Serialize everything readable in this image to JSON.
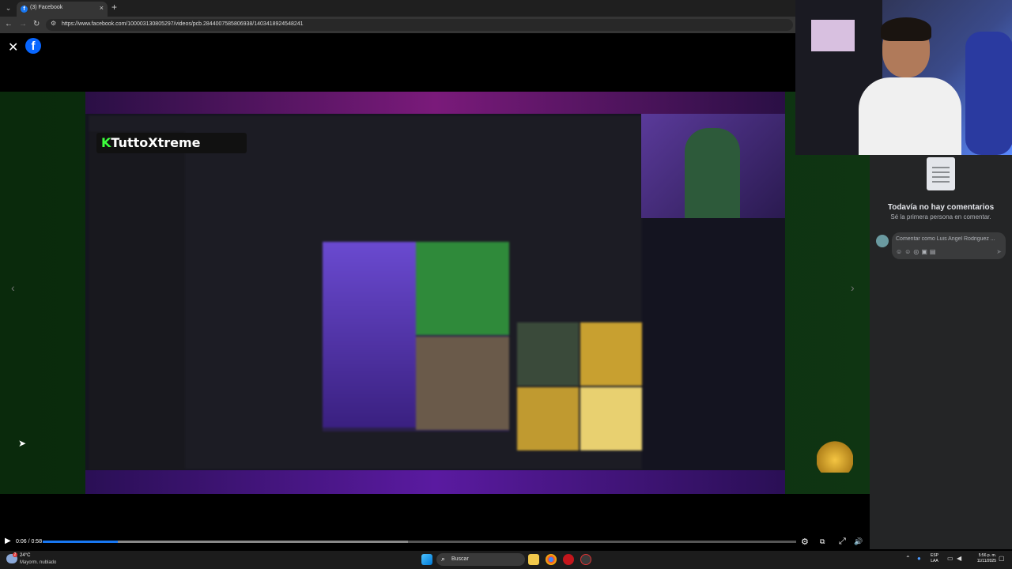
{
  "browser": {
    "tab_title": "(3) Facebook",
    "tab_favicon": "f",
    "tab_close": "×",
    "new_tab": "+",
    "tab_list": "⌄",
    "url": "https://www.facebook.com/100003130805297/videos/pcb.2844007585806938/1403418924548241",
    "back": "←",
    "forward": "→",
    "reload": "↻",
    "site_info": "⚙"
  },
  "viewer": {
    "close": "✕",
    "fb_logo": "f",
    "prev_arrow": "‹",
    "next_arrow": "›"
  },
  "video": {
    "overlay_logo_k": "K",
    "overlay_logo_text": "TuttoXtreme"
  },
  "player": {
    "play_icon": "▶",
    "time": "0:06 / 0:58",
    "progress": 0.1,
    "buffered": 0.485,
    "settings_icon": "⚙",
    "captions_icon": "⧉",
    "fullscreen_icon": "⤢",
    "volume_icon": "🔊"
  },
  "comments": {
    "title": "Todavía no hay comentarios",
    "subtitle": "Sé la primera persona en comentar.",
    "placeholder": "Comentar como Luis Angel Rodriguez ...",
    "tools": "☺☺◎▣▤",
    "send": "➤"
  },
  "taskbar": {
    "temperature": "24°C",
    "condition": "Mayorm. nublado",
    "weather_badge": "2",
    "search_label": "Buscar",
    "search_icon": "⌕",
    "tray_chevron": "⌃",
    "lang_line1": "ESP",
    "lang_line2": "LAA",
    "time": "5:56 p. m.",
    "date": "11/11/2025"
  },
  "colors": {
    "facebook_blue": "#0866ff",
    "progress_blue": "#1877f2",
    "panel_bg": "#242526"
  }
}
